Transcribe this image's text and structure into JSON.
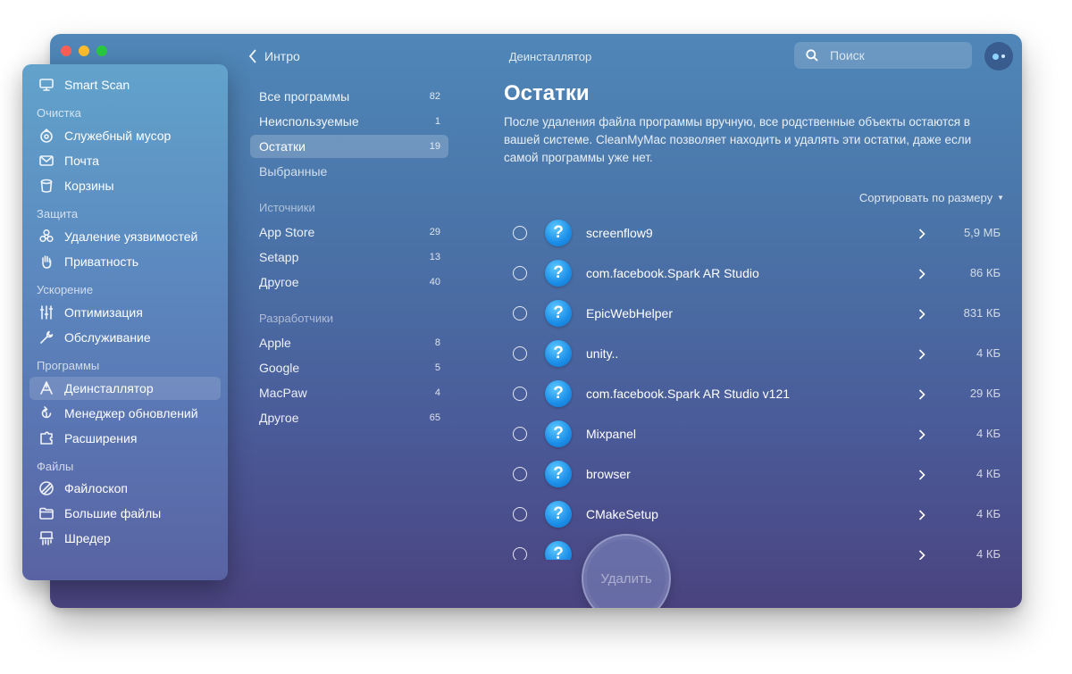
{
  "window": {
    "title": "Деинсталлятор",
    "back_label": "Интро",
    "search_placeholder": "Поиск"
  },
  "sidebar": {
    "top_item": {
      "label": "Smart Scan",
      "icon": "monitor-icon"
    },
    "sections": [
      {
        "title": "Очистка",
        "items": [
          {
            "label": "Служебный мусор",
            "icon": "system-junk-icon"
          },
          {
            "label": "Почта",
            "icon": "mail-icon"
          },
          {
            "label": "Корзины",
            "icon": "trash-icon"
          }
        ]
      },
      {
        "title": "Защита",
        "items": [
          {
            "label": "Удаление уязвимостей",
            "icon": "biohazard-icon"
          },
          {
            "label": "Приватность",
            "icon": "hand-icon"
          }
        ]
      },
      {
        "title": "Ускорение",
        "items": [
          {
            "label": "Оптимизация",
            "icon": "sliders-icon"
          },
          {
            "label": "Обслуживание",
            "icon": "wrench-icon"
          }
        ]
      },
      {
        "title": "Программы",
        "items": [
          {
            "label": "Деинсталлятор",
            "icon": "uninstaller-icon",
            "active": true
          },
          {
            "label": "Менеджер обновлений",
            "icon": "updater-icon"
          },
          {
            "label": "Расширения",
            "icon": "extensions-icon"
          }
        ]
      },
      {
        "title": "Файлы",
        "items": [
          {
            "label": "Файлоскоп",
            "icon": "lens-icon"
          },
          {
            "label": "Большие файлы",
            "icon": "folder-icon"
          },
          {
            "label": "Шредер",
            "icon": "shredder-icon"
          }
        ]
      }
    ]
  },
  "categories": {
    "main": [
      {
        "label": "Все программы",
        "count": "82"
      },
      {
        "label": "Неиспользуемые",
        "count": "1"
      },
      {
        "label": "Остатки",
        "count": "19",
        "active": true
      },
      {
        "label": "Выбранные",
        "count": ""
      }
    ],
    "sources_title": "Источники",
    "sources": [
      {
        "label": "App Store",
        "count": "29"
      },
      {
        "label": "Setapp",
        "count": "13"
      },
      {
        "label": "Другое",
        "count": "40"
      }
    ],
    "developers_title": "Разработчики",
    "developers": [
      {
        "label": "Apple",
        "count": "8"
      },
      {
        "label": "Google",
        "count": "5"
      },
      {
        "label": "MacPaw",
        "count": "4"
      },
      {
        "label": "Другое",
        "count": "65"
      }
    ]
  },
  "main": {
    "heading": "Остатки",
    "description": "После удаления файла программы вручную, все родственные объекты остаются в вашей системе. CleanMyMac позволяет находить и удалять эти остатки, даже если самой программы уже нет.",
    "sort_label": "Сортировать по размеру",
    "items": [
      {
        "name": "screenflow9",
        "size": "5,9 МБ"
      },
      {
        "name": "com.facebook.Spark AR Studio",
        "size": "86 КБ"
      },
      {
        "name": "EpicWebHelper",
        "size": "831 КБ"
      },
      {
        "name": "unity..",
        "size": "4 КБ"
      },
      {
        "name": "com.facebook.Spark AR Studio v121",
        "size": "29 КБ"
      },
      {
        "name": "Mixpanel",
        "size": "4 КБ"
      },
      {
        "name": "browser",
        "size": "4 КБ"
      },
      {
        "name": "CMakeSetup",
        "size": "4 КБ"
      },
      {
        "name": "",
        "size": "4 КБ"
      }
    ],
    "remove_label": "Удалить"
  }
}
